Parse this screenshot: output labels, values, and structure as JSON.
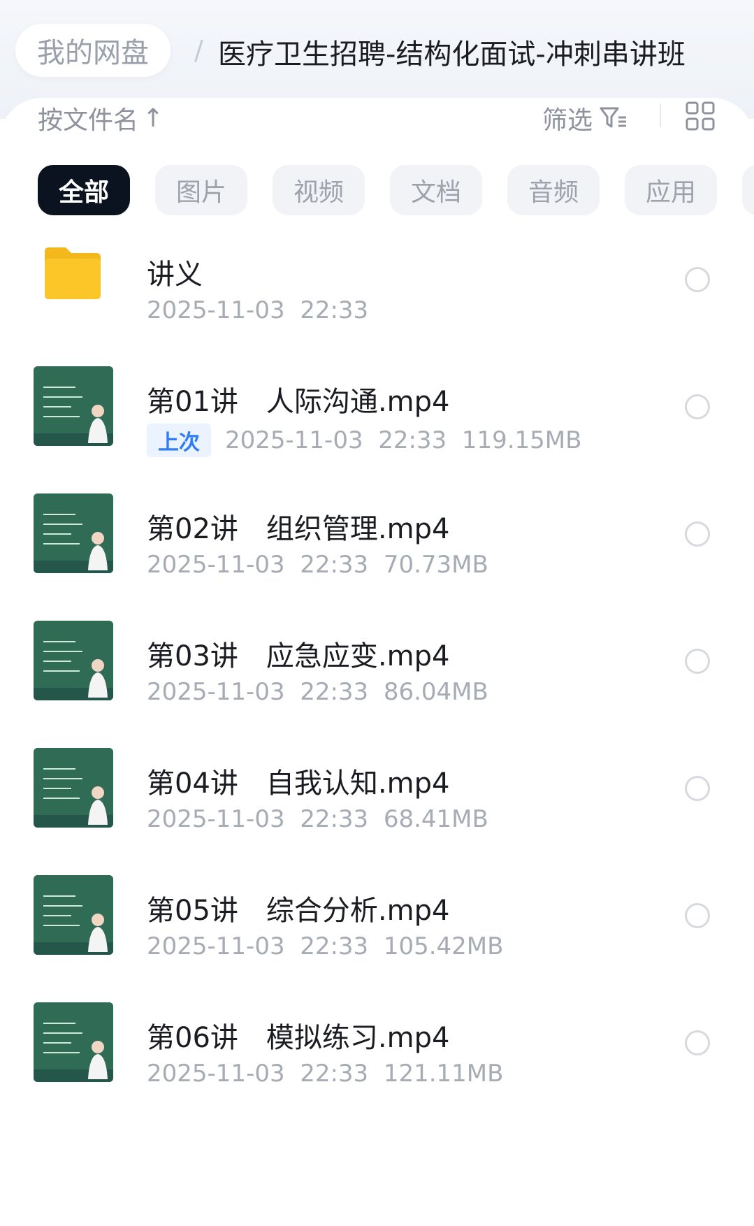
{
  "breadcrumb": {
    "root": "我的网盘",
    "separator": "/",
    "current": "医疗卫生招聘-结构化面试-冲刺串讲班"
  },
  "toolbar": {
    "sort_label": "按文件名",
    "sort_icon": "arrow-up-icon",
    "filter_label": "筛选",
    "filter_icon": "filter-icon",
    "view_icon": "grid-view-icon"
  },
  "chips": [
    "全部",
    "图片",
    "视频",
    "文档",
    "音频",
    "应用"
  ],
  "active_chip": "全部",
  "files": [
    {
      "name": "讲义",
      "date": "2025-11-03  22:33",
      "size": "",
      "type": "folder",
      "badge": ""
    },
    {
      "name": "第01讲　人际沟通.mp4",
      "date": "2025-11-03  22:33",
      "size": "119.15MB",
      "type": "video",
      "badge": "上次"
    },
    {
      "name": "第02讲　组织管理.mp4",
      "date": "2025-11-03  22:33",
      "size": "70.73MB",
      "type": "video",
      "badge": ""
    },
    {
      "name": "第03讲　应急应变.mp4",
      "date": "2025-11-03  22:33",
      "size": "86.04MB",
      "type": "video",
      "badge": ""
    },
    {
      "name": "第04讲　自我认知.mp4",
      "date": "2025-11-03  22:33",
      "size": "68.41MB",
      "type": "video",
      "badge": ""
    },
    {
      "name": "第05讲　综合分析.mp4",
      "date": "2025-11-03  22:33",
      "size": "105.42MB",
      "type": "video",
      "badge": ""
    },
    {
      "name": "第06讲　模拟练习.mp4",
      "date": "2025-11-03  22:33",
      "size": "121.11MB",
      "type": "video",
      "badge": ""
    }
  ],
  "colors": {
    "accent_dark": "#0c1320",
    "badge_text": "#2f7cf6",
    "folder_yellow": "#fcc629",
    "thumb_green": "#2f6b55"
  }
}
